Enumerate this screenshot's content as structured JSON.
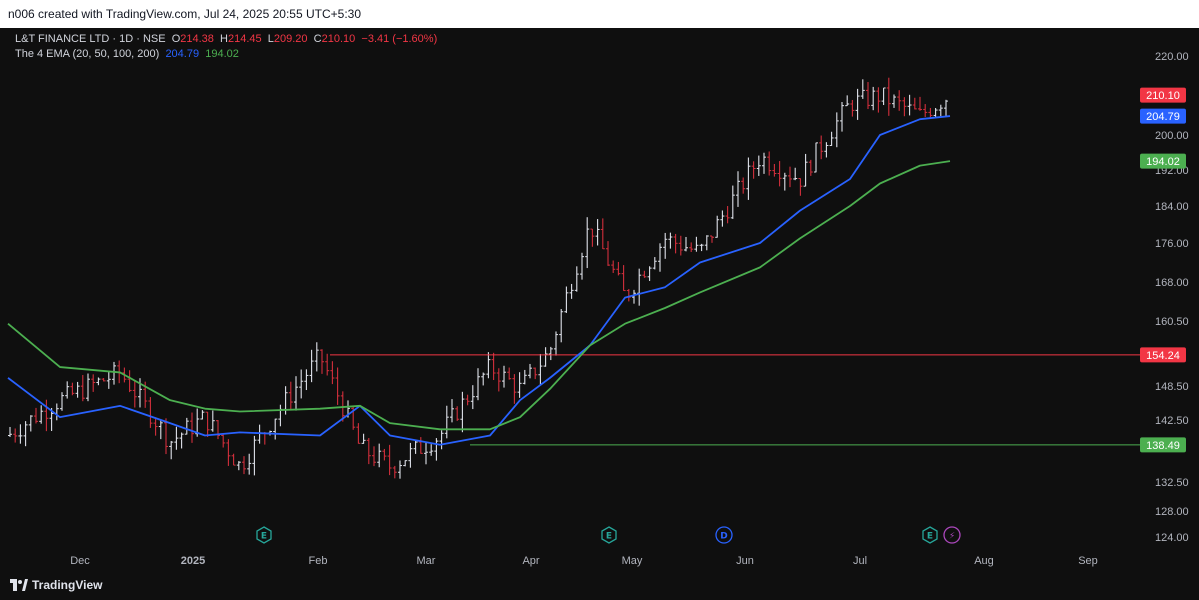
{
  "header": {
    "credit": "n006 created with TradingView.com, Jul 24, 2025 20:55 UTC+5:30"
  },
  "legend": {
    "symbol": "L&T FINANCE LTD · 1D · NSE",
    "o_label": "O",
    "o_value": "214.38",
    "h_label": "H",
    "h_value": "214.45",
    "l_label": "L",
    "l_value": "209.20",
    "c_label": "C",
    "c_value": "210.10",
    "change": "−3.41 (−1.60%)",
    "indicator": "The 4 EMA (20, 50, 100, 200)",
    "ema_fast_value": "204.79",
    "ema_slow_value": "194.02"
  },
  "footer": {
    "brand": "TradingView"
  },
  "colors": {
    "background": "#0f0f0f",
    "bar_up": "#e0e3eb",
    "bar_down": "#d32f3c",
    "ema_fast": "#2962ff",
    "ema_slow": "#4caf50",
    "hline_high": "#f23645",
    "hline_low": "#4caf50"
  },
  "chart_data": {
    "type": "ohlc",
    "title": "L&T FINANCE LTD · 1D · NSE",
    "y_axis_ticks": [
      "220.00",
      "200.00",
      "192.00",
      "184.00",
      "176.00",
      "168.00",
      "160.50",
      "148.50",
      "142.50",
      "132.50",
      "128.00",
      "124.00"
    ],
    "x_axis_ticks": [
      "Dec",
      "2025",
      "Feb",
      "Mar",
      "Apr",
      "May",
      "Jun",
      "Jul",
      "Aug",
      "Sep"
    ],
    "ylim": [
      121.5,
      223
    ],
    "grid": false,
    "price_close_approx": [
      {
        "period": "late Nov",
        "close": 140
      },
      {
        "period": "early Dec",
        "close": 146
      },
      {
        "period": "mid Dec",
        "close": 151
      },
      {
        "period": "late Dec",
        "close": 139
      },
      {
        "period": "early Jan",
        "close": 143
      },
      {
        "period": "late Jan",
        "close": 135
      },
      {
        "period": "early Feb",
        "close": 154
      },
      {
        "period": "mid Feb",
        "close": 138
      },
      {
        "period": "early Mar",
        "close": 135
      },
      {
        "period": "mid Mar",
        "close": 140
      },
      {
        "period": "late Mar",
        "close": 152
      },
      {
        "period": "early Apr",
        "close": 148
      },
      {
        "period": "mid Apr",
        "close": 155
      },
      {
        "period": "late Apr",
        "close": 180
      },
      {
        "period": "early May",
        "close": 165
      },
      {
        "period": "mid May",
        "close": 177
      },
      {
        "period": "late May",
        "close": 174
      },
      {
        "period": "early Jun",
        "close": 195
      },
      {
        "period": "mid Jun",
        "close": 190
      },
      {
        "period": "late Jun",
        "close": 208
      },
      {
        "period": "early Jul",
        "close": 210
      },
      {
        "period": "mid Jul",
        "close": 205
      },
      {
        "period": "Jul 24",
        "close": 210.1
      }
    ],
    "series": [
      {
        "name": "204.79",
        "color": "#2962ff",
        "values": [
          150,
          143,
          145,
          142,
          140,
          140.5,
          140,
          145,
          140,
          138.5,
          140,
          146,
          150,
          156,
          165,
          167,
          172,
          176,
          183,
          190,
          200,
          204,
          204.79
        ]
      },
      {
        "name": "194.02",
        "color": "#4caf50",
        "values": [
          160,
          152,
          151,
          146,
          144.5,
          144,
          144.5,
          145,
          142,
          141,
          141,
          143,
          148,
          156,
          160,
          163,
          166,
          171,
          177,
          184,
          189,
          193,
          194.02
        ]
      }
    ],
    "horizontal_lines": [
      {
        "value": "154.24",
        "color": "#f23645"
      },
      {
        "value": "138.49",
        "color": "#4caf50"
      }
    ],
    "price_labels": [
      {
        "value": "210.10",
        "color": "#f23645"
      },
      {
        "value": "204.79",
        "color": "#2962ff"
      },
      {
        "value": "194.02",
        "color": "#4caf50"
      }
    ],
    "event_markers": [
      {
        "label": "E",
        "period": "late Jan",
        "color": "#26a69a"
      },
      {
        "label": "E",
        "period": "late Apr",
        "color": "#26a69a"
      },
      {
        "label": "D",
        "period": "late May",
        "color": "#2962ff"
      },
      {
        "label": "E",
        "period": "Jul 22",
        "color": "#26a69a"
      },
      {
        "label": "⚡",
        "period": "Jul 24",
        "color": "#ab47bc"
      }
    ]
  }
}
